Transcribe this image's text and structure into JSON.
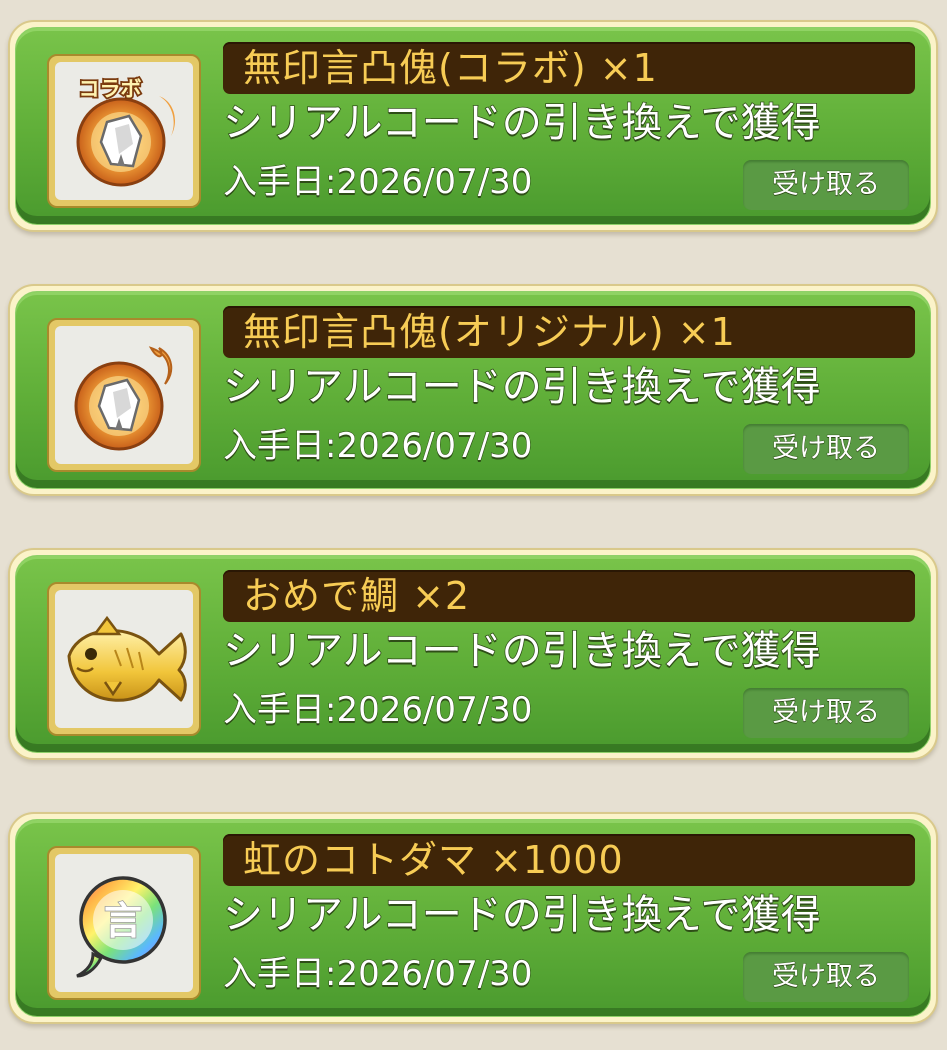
{
  "items": [
    {
      "icon": "crystal-orb-collab-icon",
      "badge": "コラボ",
      "title": "無印言凸傀(コラボ) ×1",
      "description": "シリアルコードの引き換えで獲得",
      "date": "入手日:2026/07/30",
      "button_label": "受け取る"
    },
    {
      "icon": "crystal-orb-original-icon",
      "title": "無印言凸傀(オリジナル) ×1",
      "description": "シリアルコードの引き換えで獲得",
      "date": "入手日:2026/07/30",
      "button_label": "受け取る"
    },
    {
      "icon": "golden-sea-bream-icon",
      "title": "おめで鯛 ×2",
      "description": "シリアルコードの引き換えで獲得",
      "date": "入手日:2026/07/30",
      "button_label": "受け取る"
    },
    {
      "icon": "rainbow-kotodama-bubble-icon",
      "badge": "言",
      "title": "虹のコトダマ ×1000",
      "description": "シリアルコードの引き換えで獲得",
      "date": "入手日:2026/07/30",
      "button_label": "受け取る"
    }
  ],
  "colors": {
    "background": "#e6e0d2",
    "card_green": "#5fae38",
    "title_bar": "#3f2508",
    "title_text": "#f7cc55",
    "button": "#5a9a44"
  }
}
